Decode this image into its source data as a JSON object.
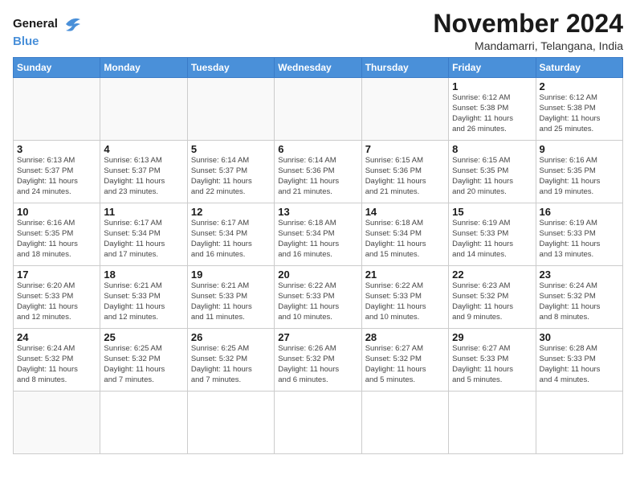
{
  "logo": {
    "line1": "General",
    "line2": "Blue"
  },
  "header": {
    "month": "November 2024",
    "location": "Mandamarri, Telangana, India"
  },
  "weekdays": [
    "Sunday",
    "Monday",
    "Tuesday",
    "Wednesday",
    "Thursday",
    "Friday",
    "Saturday"
  ],
  "days": [
    {
      "day": "",
      "info": ""
    },
    {
      "day": "",
      "info": ""
    },
    {
      "day": "",
      "info": ""
    },
    {
      "day": "",
      "info": ""
    },
    {
      "day": "",
      "info": ""
    },
    {
      "day": "1",
      "info": "Sunrise: 6:12 AM\nSunset: 5:38 PM\nDaylight: 11 hours\nand 26 minutes."
    },
    {
      "day": "2",
      "info": "Sunrise: 6:12 AM\nSunset: 5:38 PM\nDaylight: 11 hours\nand 25 minutes."
    },
    {
      "day": "3",
      "info": "Sunrise: 6:13 AM\nSunset: 5:37 PM\nDaylight: 11 hours\nand 24 minutes."
    },
    {
      "day": "4",
      "info": "Sunrise: 6:13 AM\nSunset: 5:37 PM\nDaylight: 11 hours\nand 23 minutes."
    },
    {
      "day": "5",
      "info": "Sunrise: 6:14 AM\nSunset: 5:37 PM\nDaylight: 11 hours\nand 22 minutes."
    },
    {
      "day": "6",
      "info": "Sunrise: 6:14 AM\nSunset: 5:36 PM\nDaylight: 11 hours\nand 21 minutes."
    },
    {
      "day": "7",
      "info": "Sunrise: 6:15 AM\nSunset: 5:36 PM\nDaylight: 11 hours\nand 21 minutes."
    },
    {
      "day": "8",
      "info": "Sunrise: 6:15 AM\nSunset: 5:35 PM\nDaylight: 11 hours\nand 20 minutes."
    },
    {
      "day": "9",
      "info": "Sunrise: 6:16 AM\nSunset: 5:35 PM\nDaylight: 11 hours\nand 19 minutes."
    },
    {
      "day": "10",
      "info": "Sunrise: 6:16 AM\nSunset: 5:35 PM\nDaylight: 11 hours\nand 18 minutes."
    },
    {
      "day": "11",
      "info": "Sunrise: 6:17 AM\nSunset: 5:34 PM\nDaylight: 11 hours\nand 17 minutes."
    },
    {
      "day": "12",
      "info": "Sunrise: 6:17 AM\nSunset: 5:34 PM\nDaylight: 11 hours\nand 16 minutes."
    },
    {
      "day": "13",
      "info": "Sunrise: 6:18 AM\nSunset: 5:34 PM\nDaylight: 11 hours\nand 16 minutes."
    },
    {
      "day": "14",
      "info": "Sunrise: 6:18 AM\nSunset: 5:34 PM\nDaylight: 11 hours\nand 15 minutes."
    },
    {
      "day": "15",
      "info": "Sunrise: 6:19 AM\nSunset: 5:33 PM\nDaylight: 11 hours\nand 14 minutes."
    },
    {
      "day": "16",
      "info": "Sunrise: 6:19 AM\nSunset: 5:33 PM\nDaylight: 11 hours\nand 13 minutes."
    },
    {
      "day": "17",
      "info": "Sunrise: 6:20 AM\nSunset: 5:33 PM\nDaylight: 11 hours\nand 12 minutes."
    },
    {
      "day": "18",
      "info": "Sunrise: 6:21 AM\nSunset: 5:33 PM\nDaylight: 11 hours\nand 12 minutes."
    },
    {
      "day": "19",
      "info": "Sunrise: 6:21 AM\nSunset: 5:33 PM\nDaylight: 11 hours\nand 11 minutes."
    },
    {
      "day": "20",
      "info": "Sunrise: 6:22 AM\nSunset: 5:33 PM\nDaylight: 11 hours\nand 10 minutes."
    },
    {
      "day": "21",
      "info": "Sunrise: 6:22 AM\nSunset: 5:33 PM\nDaylight: 11 hours\nand 10 minutes."
    },
    {
      "day": "22",
      "info": "Sunrise: 6:23 AM\nSunset: 5:32 PM\nDaylight: 11 hours\nand 9 minutes."
    },
    {
      "day": "23",
      "info": "Sunrise: 6:24 AM\nSunset: 5:32 PM\nDaylight: 11 hours\nand 8 minutes."
    },
    {
      "day": "24",
      "info": "Sunrise: 6:24 AM\nSunset: 5:32 PM\nDaylight: 11 hours\nand 8 minutes."
    },
    {
      "day": "25",
      "info": "Sunrise: 6:25 AM\nSunset: 5:32 PM\nDaylight: 11 hours\nand 7 minutes."
    },
    {
      "day": "26",
      "info": "Sunrise: 6:25 AM\nSunset: 5:32 PM\nDaylight: 11 hours\nand 7 minutes."
    },
    {
      "day": "27",
      "info": "Sunrise: 6:26 AM\nSunset: 5:32 PM\nDaylight: 11 hours\nand 6 minutes."
    },
    {
      "day": "28",
      "info": "Sunrise: 6:27 AM\nSunset: 5:32 PM\nDaylight: 11 hours\nand 5 minutes."
    },
    {
      "day": "29",
      "info": "Sunrise: 6:27 AM\nSunset: 5:33 PM\nDaylight: 11 hours\nand 5 minutes."
    },
    {
      "day": "30",
      "info": "Sunrise: 6:28 AM\nSunset: 5:33 PM\nDaylight: 11 hours\nand 4 minutes."
    },
    {
      "day": "",
      "info": ""
    }
  ]
}
